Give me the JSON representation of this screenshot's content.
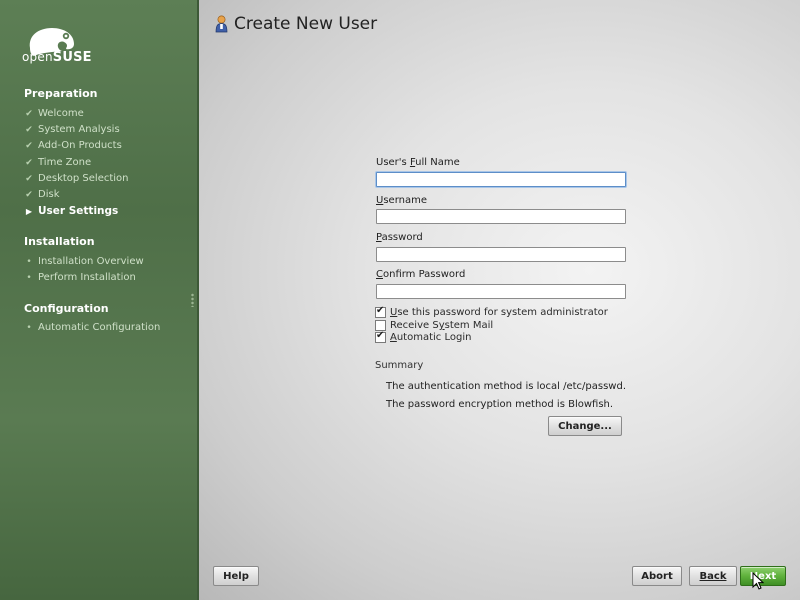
{
  "sidebar": {
    "logo_prefix": "open",
    "logo_brand": "SUSE",
    "sections": [
      {
        "title": "Preparation",
        "items": [
          {
            "label": "Welcome",
            "state": "done"
          },
          {
            "label": "System Analysis",
            "state": "done"
          },
          {
            "label": "Add-On Products",
            "state": "done"
          },
          {
            "label": "Time Zone",
            "state": "done"
          },
          {
            "label": "Desktop Selection",
            "state": "done"
          },
          {
            "label": "Disk",
            "state": "done"
          },
          {
            "label": "User Settings",
            "state": "current"
          }
        ]
      },
      {
        "title": "Installation",
        "items": [
          {
            "label": "Installation Overview",
            "state": "pending"
          },
          {
            "label": "Perform Installation",
            "state": "pending"
          }
        ]
      },
      {
        "title": "Configuration",
        "items": [
          {
            "label": "Automatic Configuration",
            "state": "pending"
          }
        ]
      }
    ]
  },
  "header": {
    "title": "Create New User",
    "icon": "user-icon"
  },
  "form": {
    "full_name": {
      "label_pre": "User's ",
      "label_key": "F",
      "label_post": "ull Name",
      "value": ""
    },
    "username": {
      "label_pre": "",
      "label_key": "U",
      "label_post": "sername",
      "value": ""
    },
    "password": {
      "label_pre": "",
      "label_key": "P",
      "label_post": "assword",
      "value": ""
    },
    "confirm": {
      "label_pre": "",
      "label_key": "C",
      "label_post": "onfirm Password",
      "value": ""
    },
    "checkboxes": [
      {
        "label_pre": "",
        "label_key": "U",
        "label_post": "se this password for system administrator",
        "checked": true
      },
      {
        "label_pre": "Receive S",
        "label_key": "y",
        "label_post": "stem Mail",
        "checked": false
      },
      {
        "label_pre": "",
        "label_key": "A",
        "label_post": "utomatic Login",
        "checked": true
      }
    ]
  },
  "summary": {
    "title": "Summary",
    "lines": [
      "The authentication method is local /etc/passwd.",
      "The password encryption method is Blowfish."
    ],
    "change_button": "Change..."
  },
  "footer": {
    "help": "Help",
    "abort": "Abort",
    "back": "Back",
    "next": "Next"
  },
  "colors": {
    "sidebar_bg": "#5a7b52",
    "next_button": "#5fb13c",
    "focus_border": "#5d8ec8"
  }
}
